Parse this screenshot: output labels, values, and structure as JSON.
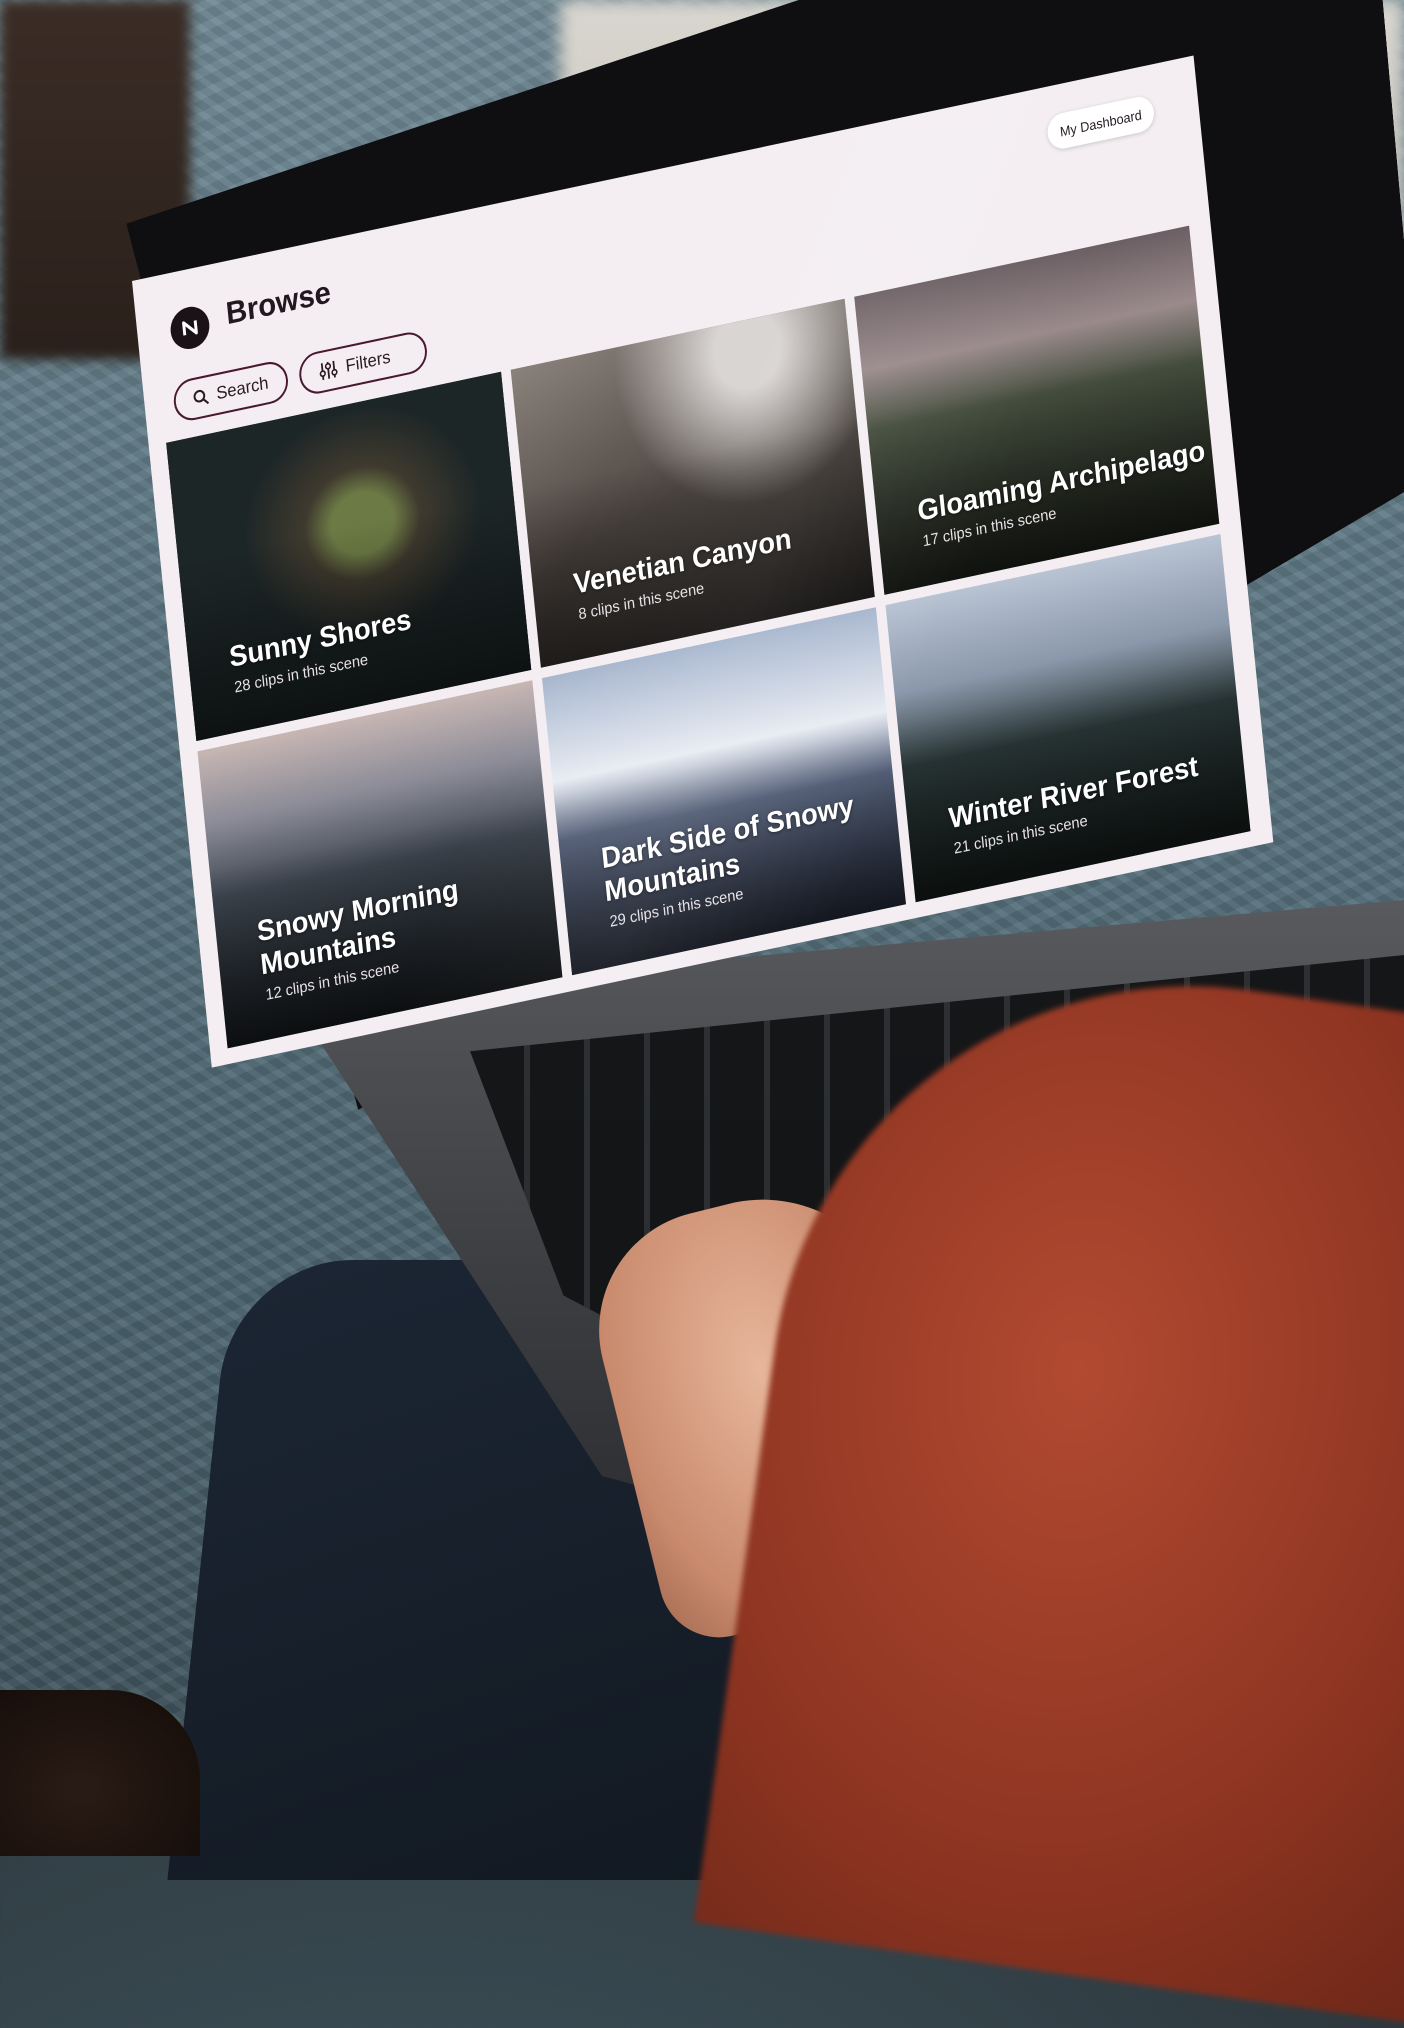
{
  "app": {
    "title": "Browse",
    "logo_glyph": "N"
  },
  "header": {
    "dashboard_label": "My Dashboard"
  },
  "toolbar": {
    "search_label": "Search",
    "filters_label": "Filters"
  },
  "scenes": [
    {
      "title": "Sunny Shores",
      "subtitle": "28 clips in this scene"
    },
    {
      "title": "Venetian Canyon",
      "subtitle": "8 clips in this scene"
    },
    {
      "title": "Gloaming Archipelago",
      "subtitle": "17 clips in this scene"
    },
    {
      "title": "Snowy Morning Mountains",
      "subtitle": "12 clips in this scene"
    },
    {
      "title": "Dark Side of Snowy Mountains",
      "subtitle": "29 clips in this scene"
    },
    {
      "title": "Winter River Forest",
      "subtitle": "21 clips in this scene"
    }
  ],
  "colors": {
    "accent": "#4a1830",
    "screen_bg": "#f4eef2",
    "text_dark": "#221820"
  },
  "icons": {
    "logo": "brand-logo-icon",
    "search": "search-icon",
    "filters": "sliders-icon"
  }
}
